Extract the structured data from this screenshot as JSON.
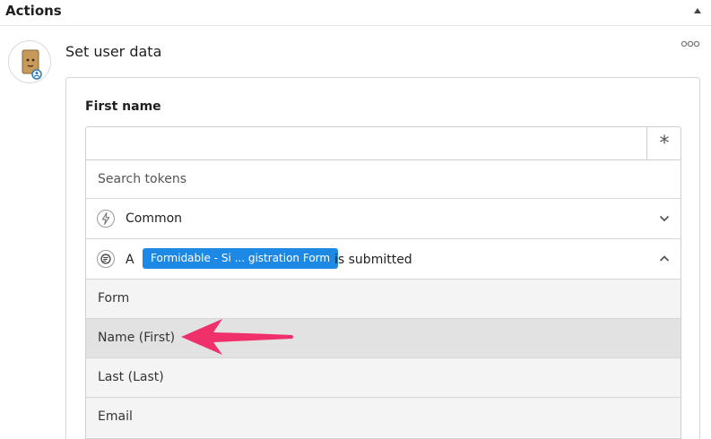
{
  "header": {
    "title": "Actions"
  },
  "action": {
    "title": "Set user data"
  },
  "field": {
    "label": "First name",
    "value": "",
    "token_button": "*"
  },
  "dropdown": {
    "search_placeholder": "Search tokens",
    "groups": [
      {
        "label": "Common",
        "expanded": false
      },
      {
        "prefix": "A",
        "badge": "Formidable - Si ... gistration Form",
        "suffix": "is submitted",
        "expanded": true
      }
    ],
    "tokens": [
      {
        "label": "Form"
      },
      {
        "label": "Name (First)",
        "highlighted": true
      },
      {
        "label": "Last (Last)"
      },
      {
        "label": "Email"
      }
    ]
  },
  "colors": {
    "badge": "#1e88e5",
    "arrow": "#f0306a",
    "highlight": "#e2e2e2"
  }
}
